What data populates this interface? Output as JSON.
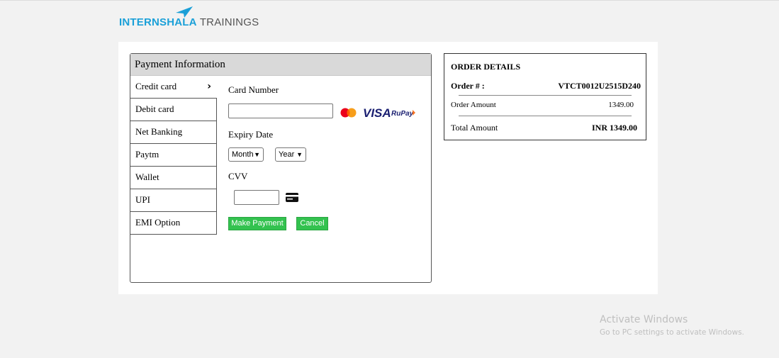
{
  "brand": {
    "name_part1": "INTERNSHALA",
    "name_part2": "TRAININGS",
    "accent_color": "#1ba0d8",
    "icon": "paper-plane-icon"
  },
  "payment": {
    "header": "Payment Information",
    "tabs": [
      {
        "label": "Credit card",
        "active": true
      },
      {
        "label": "Debit card",
        "active": false
      },
      {
        "label": "Net Banking",
        "active": false
      },
      {
        "label": "Paytm",
        "active": false
      },
      {
        "label": "Wallet",
        "active": false
      },
      {
        "label": "UPI",
        "active": false
      },
      {
        "label": "EMI Option",
        "active": false
      }
    ],
    "form": {
      "card_number_label": "Card Number",
      "card_number_value": "",
      "expiry_label": "Expiry Date",
      "month_select": "Month",
      "year_select": "Year",
      "cvv_label": "CVV",
      "cvv_value": "",
      "make_payment_label": "Make Payment",
      "cancel_label": "Cancel",
      "button_color": "#33c24f",
      "card_brands": [
        "mastercard-icon",
        "visa-logo",
        "rupay-logo"
      ],
      "visa_text": "VISA",
      "rupay_text": "RuPay"
    }
  },
  "order": {
    "title": "ORDER DETAILS",
    "order_no_label": "Order # :",
    "order_no_value": "VTCT0012U2515D240",
    "amount_label": "Order Amount",
    "amount_value": "1349.00",
    "total_label": "Total Amount",
    "total_value": "INR 1349.00"
  },
  "watermark": {
    "line1": "Activate Windows",
    "line2": "Go to PC settings to activate Windows."
  }
}
